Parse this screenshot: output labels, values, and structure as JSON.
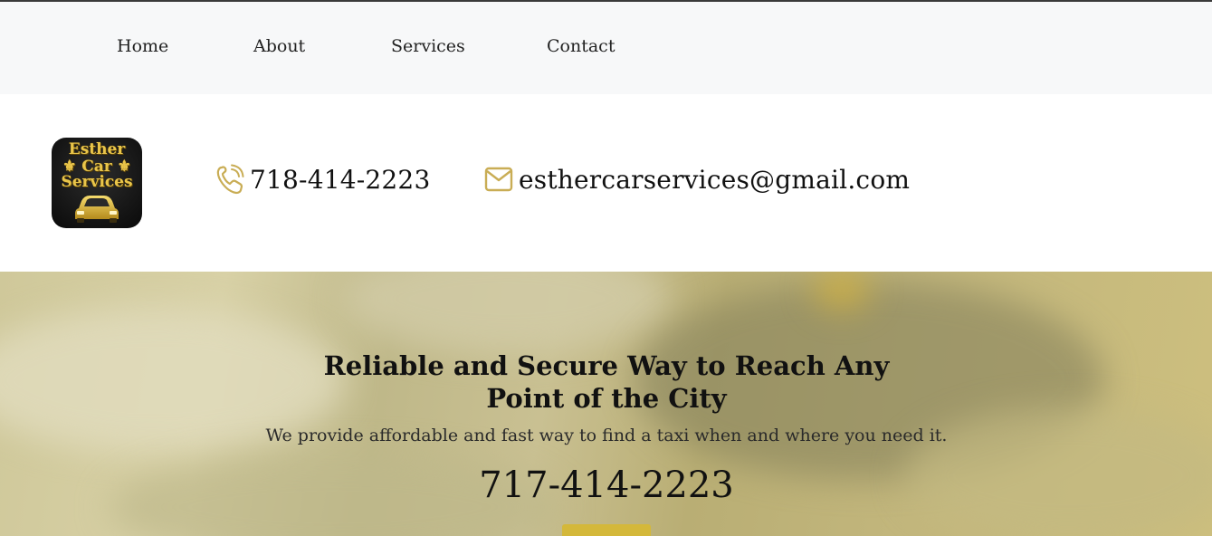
{
  "nav": {
    "items": [
      {
        "label": "Home"
      },
      {
        "label": "About"
      },
      {
        "label": "Services"
      },
      {
        "label": "Contact"
      }
    ]
  },
  "header": {
    "logo": {
      "line1": "Esther",
      "line2": "⚜ Car ⚜",
      "line3": "Services",
      "icon": "car-icon"
    },
    "phone": {
      "icon": "phone-icon",
      "text": "718-414-2223"
    },
    "email": {
      "icon": "envelope-icon",
      "text": "esthercarservices@gmail.com"
    }
  },
  "hero": {
    "title": "Reliable and Secure Way to Reach Any Point of the City",
    "subtitle": "We provide affordable and fast way to find a taxi when and where you need it.",
    "phone": "717-414-2223",
    "button_label": ""
  },
  "colors": {
    "accent_gold": "#d4b83a",
    "icon_gold": "#c9ad55",
    "nav_background": "#f7f8f9",
    "hero_tint": "#c9c092"
  }
}
